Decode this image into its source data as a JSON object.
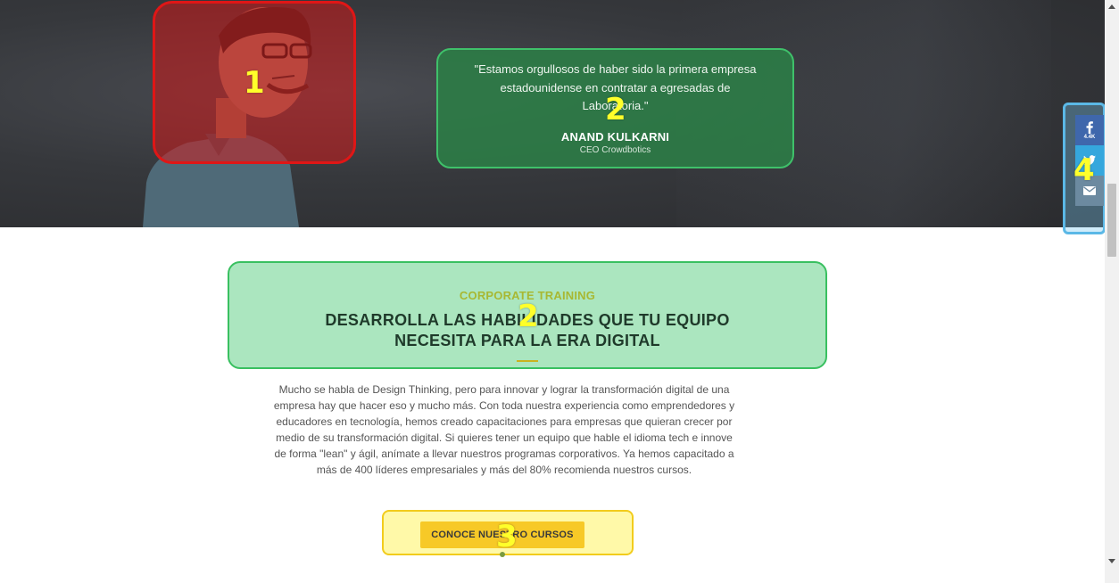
{
  "testimonial": {
    "quote": "\"Estamos orgullosos de haber sido la primera empresa estadounidense en contratar a egresadas de Laboratoria.\"",
    "author": "ANAND KULKARNI",
    "role": "CEO Crowdbotics"
  },
  "corporate": {
    "eyebrow": "CORPORATE TRAINING",
    "headline": "DESARROLLA LAS HABILIDADES QUE TU EQUIPO NECESITA PARA LA ERA DIGITAL",
    "body": "Mucho se habla de Design Thinking, pero para innovar y lograr la transformación digital de una empresa hay que hacer eso y mucho más. Con toda nuestra experiencia como emprendedores y educadores en tecnología, hemos creado capacitaciones para empresas que quieran crecer por medio de su transformación digital. Si quieres tener un equipo que hable el idioma tech e innove de forma \"lean\" y ágil, anímate a llevar nuestros programas corporativos. Ya hemos capacitado a más de 400 líderes empresariales y más del 80% recomienda nuestros cursos.",
    "cta_label": "CONOCE NUESTRO CURSOS"
  },
  "share": {
    "facebook_count": "4.4K",
    "icons": [
      "facebook-icon",
      "twitter-icon",
      "mail-icon"
    ]
  },
  "annotations": {
    "photo": "1",
    "quote": "2",
    "corporate": "2",
    "cta": "3",
    "share": "4"
  },
  "colors": {
    "photo_highlight": "#e01616",
    "quote_highlight": "#3fc16a",
    "corporate_highlight": "#39c060",
    "cta_highlight": "#f2cc1c",
    "share_highlight": "#5bb8e6",
    "cta_button": "#f7c927",
    "marker": "#ffff2a"
  }
}
